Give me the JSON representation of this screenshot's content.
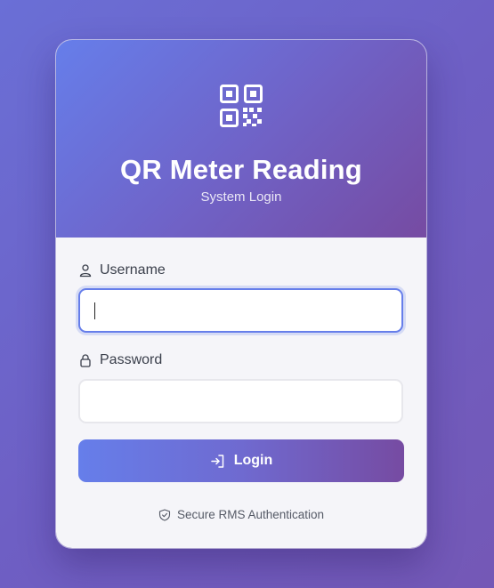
{
  "header": {
    "icon": "qr-code-icon",
    "title": "QR Meter Reading",
    "subtitle": "System Login"
  },
  "form": {
    "username": {
      "icon": "user-icon",
      "label": "Username",
      "value": "",
      "focused": true
    },
    "password": {
      "icon": "lock-icon",
      "label": "Password",
      "value": ""
    },
    "submit": {
      "icon": "sign-in-icon",
      "label": "Login"
    }
  },
  "footer": {
    "icon": "shield-check-icon",
    "text": "Secure RMS Authentication"
  },
  "colors": {
    "accent_start": "#667eea",
    "accent_end": "#764ba2",
    "card_background": "#f5f5f9"
  }
}
